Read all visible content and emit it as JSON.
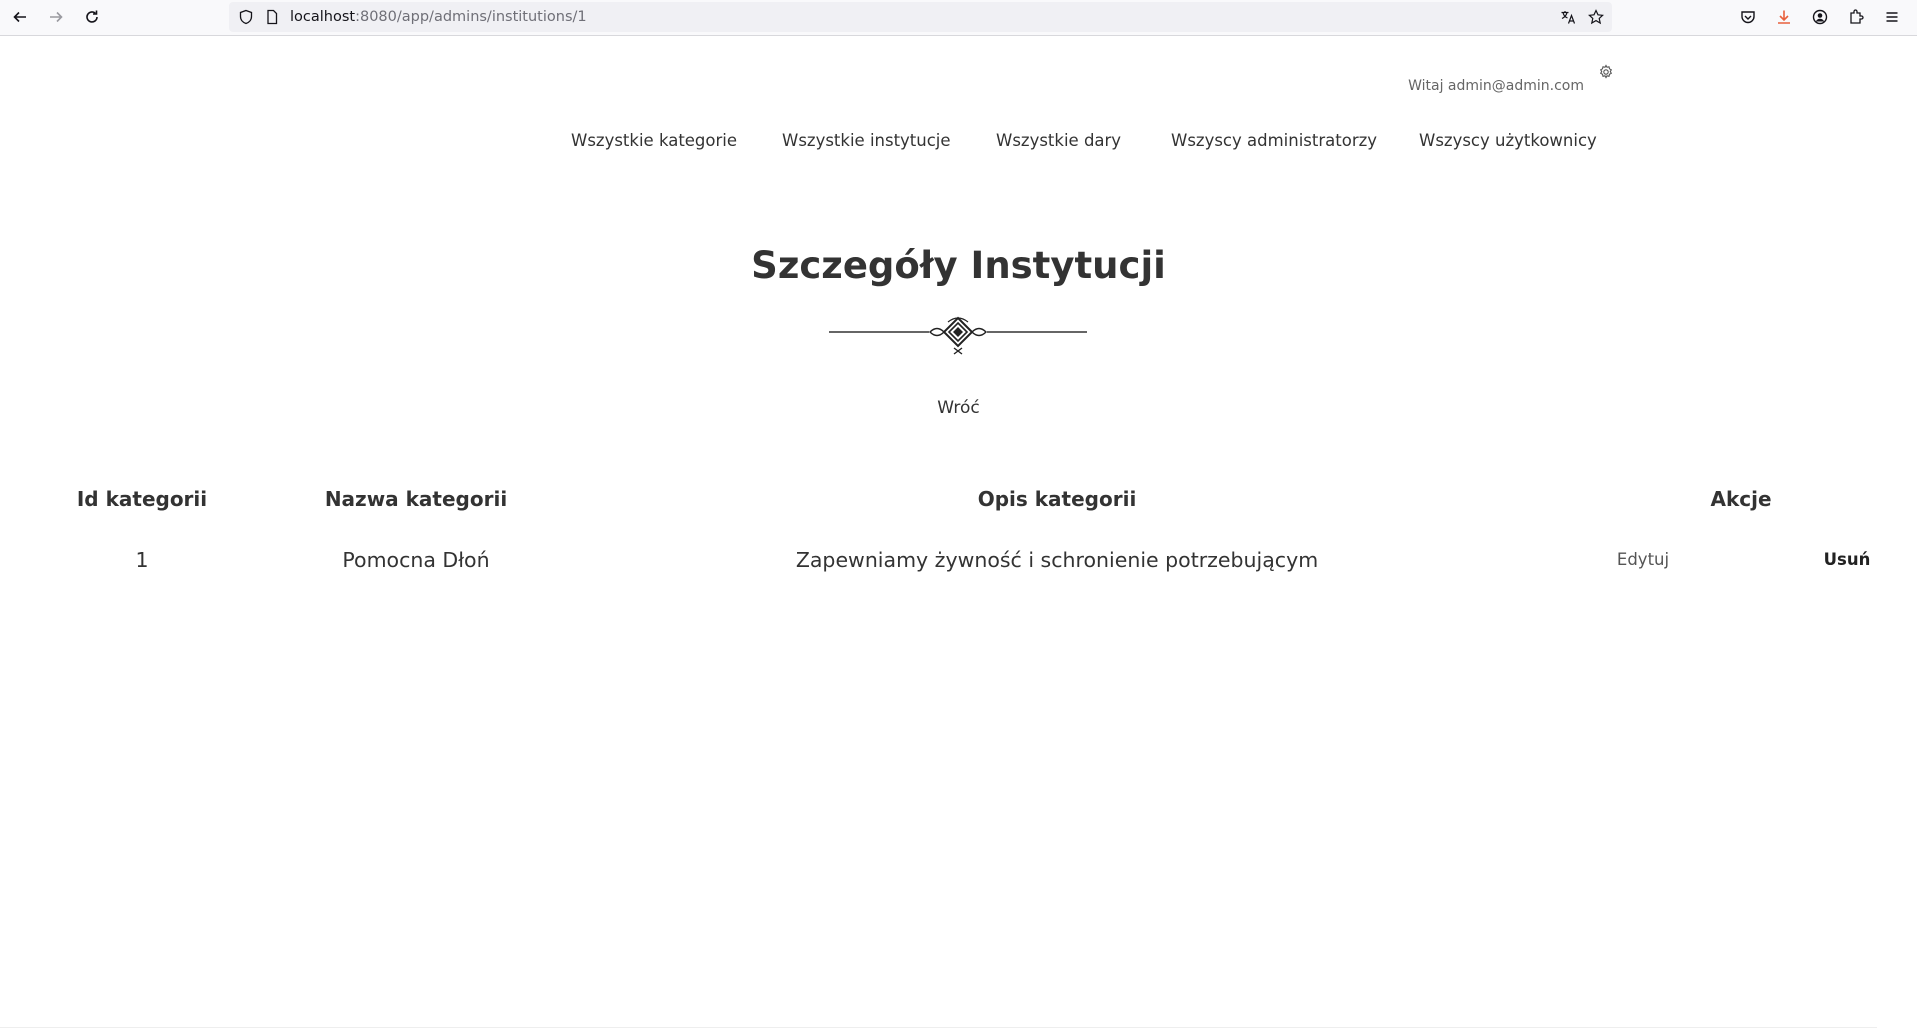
{
  "browser": {
    "url_host": "localhost",
    "url_rest": ":8080/app/admins/institutions/1",
    "icons": [
      "back-icon",
      "forward-icon",
      "reload-icon",
      "shield-icon",
      "page-icon",
      "translate-icon",
      "bookmark-star-icon",
      "pocket-icon",
      "download-icon",
      "account-icon",
      "extensions-icon",
      "menu-icon"
    ]
  },
  "header": {
    "greeting": "Witaj admin@admin.com"
  },
  "nav": {
    "items": [
      {
        "label": "Wszystkie kategorie"
      },
      {
        "label": "Wszystkie instytucje"
      },
      {
        "label": "Wszystkie dary"
      },
      {
        "label": "Wszyscy administratorzy"
      },
      {
        "label": "Wszyscy użytkownicy"
      }
    ]
  },
  "main": {
    "title": "Szczegóły Instytucji",
    "back_link": "Wróć"
  },
  "table": {
    "headers": [
      "Id kategorii",
      "Nazwa kategorii",
      "Opis kategorii",
      "Akcje"
    ],
    "rows": [
      {
        "id": "1",
        "name": "Pomocna Dłoń",
        "description": "Zapewniamy żywność i schronienie potrzebującym",
        "edit_label": "Edytuj",
        "delete_label": "Usuń"
      }
    ]
  },
  "colors": {
    "download_accent": "#e8603c",
    "text": "#333333"
  }
}
